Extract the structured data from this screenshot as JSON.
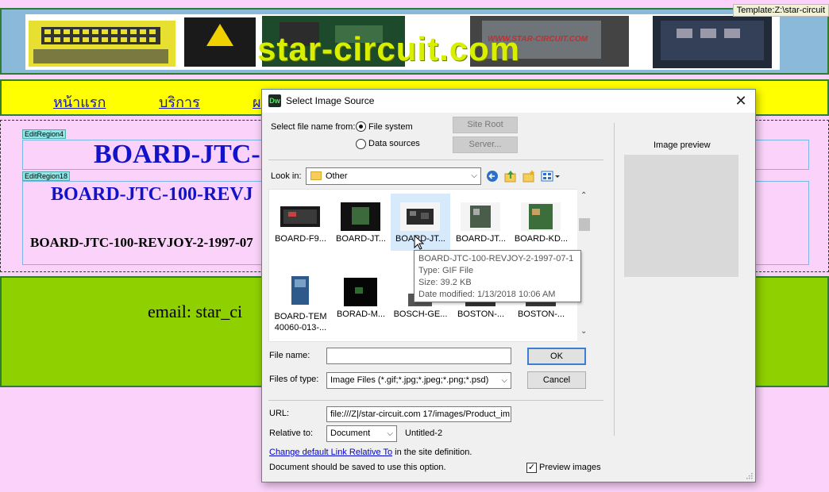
{
  "page": {
    "template_tag": "Template:Z:\\star-circuit",
    "banner_text": "star-circuit.com",
    "banner_url_text": "WWW.STAR-CIRCUIT.COM",
    "nav": [
      "หน้าแรก",
      "บริการ",
      "ผ"
    ],
    "region_tag_1": "EditRegion4",
    "region_tag_2": "EditRegion18",
    "title_1": "BOARD-JTC-",
    "title_2": "BOARD-JTC-100-REVJ",
    "title_3": "BOARD-JTC-100-REVJOY-2-1997-07",
    "email": "email:  star_ci"
  },
  "dialog": {
    "app_icon": "Dw",
    "title": "Select Image Source",
    "select_from_label": "Select file name from:",
    "radio_file_system": "File system",
    "radio_data_sources": "Data sources",
    "site_root_button": "Site Root",
    "server_button": "Server...",
    "look_in_label": "Look in:",
    "look_in_value": "Other",
    "preview_label": "Image preview",
    "files": [
      {
        "name": "BOARD-F9...",
        "selected": false
      },
      {
        "name": "BOARD-JT...",
        "selected": false
      },
      {
        "name": "BOARD-JT...",
        "selected": true
      },
      {
        "name": "BOARD-JT...",
        "selected": false
      },
      {
        "name": "BOARD-KD...",
        "selected": false
      },
      {
        "name": "BOARD-TEM",
        "name_line2": "40060-013-...",
        "selected": false
      },
      {
        "name": "BORAD-M...",
        "selected": false
      },
      {
        "name": "BOSCH-GE...",
        "selected": false
      },
      {
        "name": "BOSTON-...",
        "selected": false
      },
      {
        "name": "BOSTON-...",
        "selected": false
      }
    ],
    "tooltip": {
      "name": "BOARD-JTC-100-REVJOY-2-1997-07-1",
      "type": "Type: GIF File",
      "size": "Size: 39.2 KB",
      "date": "Date modified: 1/13/2018 10:06 AM"
    },
    "file_name_label": "File name:",
    "file_name_value": "",
    "ok_button": "OK",
    "files_of_type_label": "Files of type:",
    "files_of_type_value": "Image Files (*.gif;*.jpg;*.jpeg;*.png;*.psd)",
    "cancel_button": "Cancel",
    "url_label": "URL:",
    "url_value": "file:///Z|/star-circuit.com 17/images/Product_im",
    "relative_to_label": "Relative to:",
    "relative_to_value": "Document",
    "relative_doc_name": "Untitled-2",
    "change_link_text": "Change default Link Relative To",
    "change_link_suffix": " in the site definition.",
    "save_note": "Document should be saved to use this option.",
    "preview_images_label": "Preview images",
    "preview_images_checked": true
  },
  "colors": {
    "header_bg": "#8bb9d9",
    "nav_bg": "#ffff00",
    "main_bg": "#fad2fa",
    "footer_bg": "#8ed000",
    "title_blue": "#1212c8",
    "tile_selected": "#d6eafc",
    "ok_border": "#3c7fd1"
  }
}
